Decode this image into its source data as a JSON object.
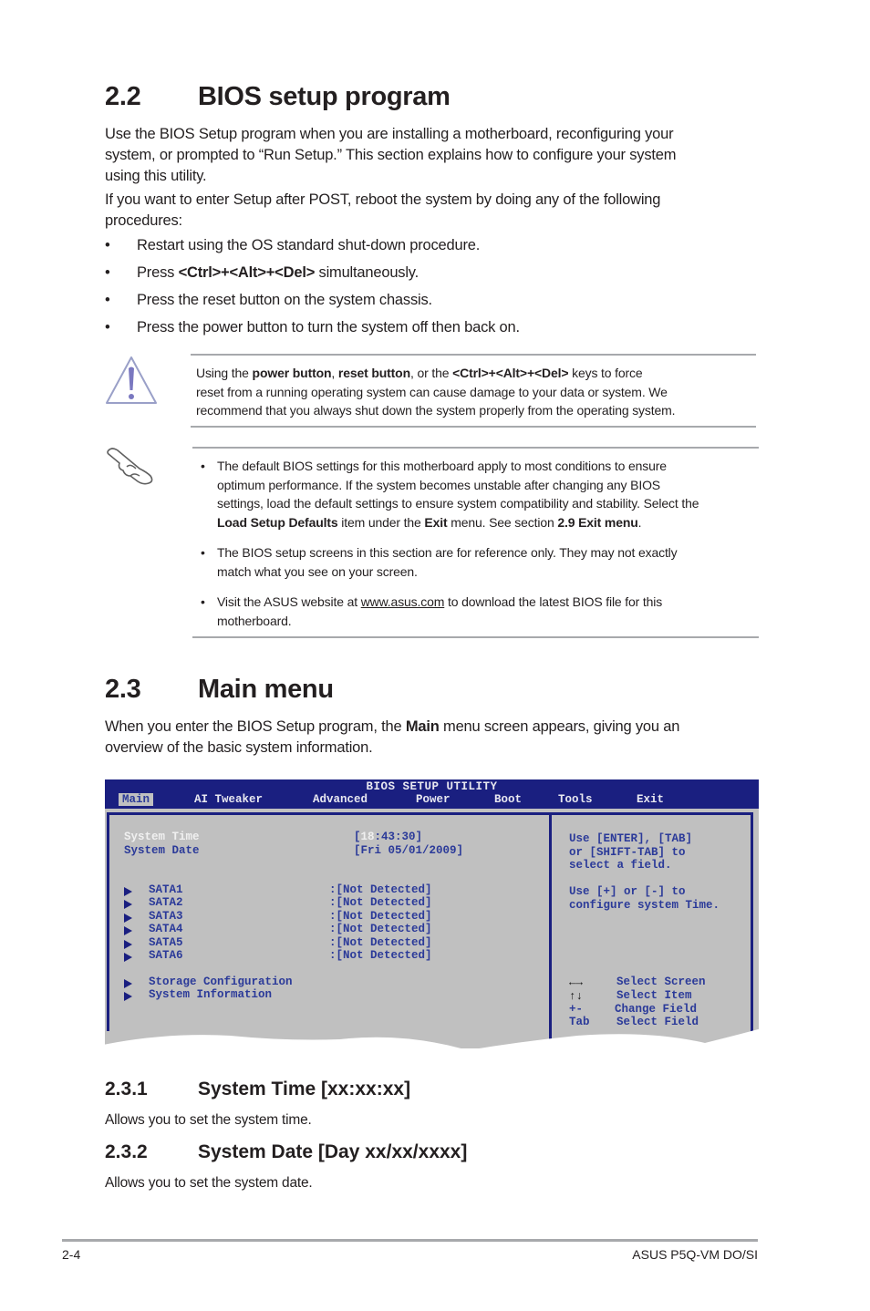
{
  "section_22": {
    "number": "2.2",
    "title": "BIOS setup program",
    "para1": "Use the BIOS Setup program when you are installing a motherboard, reconfiguring your system, or prompted to “Run Setup.” This section explains how to configure your system using this utility.",
    "para1_lines": [
      "Use the BIOS Setup program when you are installing a motherboard, reconfiguring your",
      "system, or prompted to “Run Setup.” This section explains how to configure your system",
      "using this utility."
    ],
    "para2_lines": [
      "If you want to enter Setup after POST, reboot the system by doing any of the following",
      "procedures:"
    ],
    "bullets": [
      {
        "text": "Restart using the OS standard shut-down procedure."
      },
      {
        "pre": "Press ",
        "bold": "<Ctrl>+<Alt>+<Del>",
        "post": " simultaneously."
      },
      {
        "text": "Press the reset button on the system chassis."
      },
      {
        "text": "Press the power button to turn the system off then back on."
      }
    ],
    "bullet_char": "•"
  },
  "warning_note": {
    "icon": "warning-triangle-icon",
    "line1": {
      "a": "Using the ",
      "b1": "power button",
      "c": ", ",
      "b2": "reset button",
      "d": ", or the ",
      "b3": "<Ctrl>+<Alt>+<Del>",
      "e": " keys to force"
    },
    "line2": "reset from a running operating system can cause damage to your data or system. We",
    "line3": "recommend that you always shut down the system properly from the operating system."
  },
  "info_note": {
    "icon": "pointing-hand-icon",
    "bullet1": {
      "l1": "The default BIOS settings for this motherboard apply to most conditions to ensure",
      "l2": "optimum performance. If the system becomes unstable after changing any BIOS",
      "l3": "settings, load the default settings to ensure system compatibility and stability. Select the",
      "b1": "Load Setup Defaults",
      "m1": " item under the ",
      "b2": "Exit",
      "m2": " menu. See section ",
      "b3": "2.9 Exit menu",
      "m3": "."
    },
    "bullet2": {
      "l1": "The BIOS setup screens in this section are for reference only. They may not exactly",
      "l2": "match what you see on your screen."
    },
    "bullet3": {
      "pre": "Visit the ASUS website at ",
      "link": "www.asus.com",
      "post": " to download the latest BIOS file for this",
      "l2": "motherboard."
    }
  },
  "section_23": {
    "number": "2.3",
    "title": "Main menu",
    "intro": {
      "pre": "When you enter the BIOS Setup program, the ",
      "bold": "Main",
      "post": " menu screen appears, giving you an",
      "l2": "overview of the basic system information."
    }
  },
  "bios": {
    "title": "BIOS SETUP UTILITY",
    "menus": [
      "Main",
      "AI Tweaker",
      "Advanced",
      "Power",
      "Boot",
      "Tools",
      "Exit"
    ],
    "active_menu": "Main",
    "system_time_label": "System Time",
    "system_time_value": {
      "open": "[",
      "hl": "18",
      "rest": ":43:30]"
    },
    "system_date_label": "System Date",
    "system_date_value": "[Fri 05/01/2009]",
    "sata": [
      {
        "label": "SATA1",
        "value": ":[Not Detected]"
      },
      {
        "label": "SATA2",
        "value": ":[Not Detected]"
      },
      {
        "label": "SATA3",
        "value": ":[Not Detected]"
      },
      {
        "label": "SATA4",
        "value": ":[Not Detected]"
      },
      {
        "label": "SATA5",
        "value": ":[Not Detected]"
      },
      {
        "label": "SATA6",
        "value": ":[Not Detected]"
      }
    ],
    "submenus": [
      "Storage Configuration",
      "System Information"
    ],
    "help": [
      "Use [ENTER], [TAB]",
      "or [SHIFT-TAB] to",
      "select a field.",
      "Use [+] or [-] to",
      "configure system Time."
    ],
    "keys": [
      {
        "key": "←→",
        "action": "Select Screen"
      },
      {
        "key": "↑↓",
        "action": "Select Item"
      },
      {
        "key": "+-",
        "action": "Change Field"
      },
      {
        "key": "Tab",
        "action": "Select Field"
      }
    ],
    "colors": {
      "bar": "#1a1f80",
      "panel": "#c0c0c0",
      "text": "#2b3a99",
      "highlight": "#f0f0f0"
    }
  },
  "section_231": {
    "number": "2.3.1",
    "title": "System Time [xx:xx:xx]",
    "body": "Allows you to set the system time."
  },
  "section_232": {
    "number": "2.3.2",
    "title": "System Date [Day xx/xx/xxxx]",
    "body": "Allows you to set the system date."
  },
  "footer": {
    "page": "2-4",
    "product": "ASUS P5Q-VM DO/SI"
  }
}
